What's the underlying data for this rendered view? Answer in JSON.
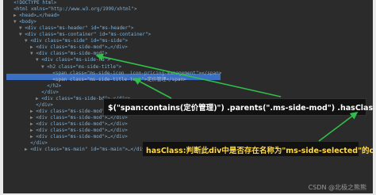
{
  "dom_lines": [
    {
      "indent": 0,
      "tri": "",
      "text": "<!DOCTYPE html>"
    },
    {
      "indent": 0,
      "tri": "",
      "text": "<html xmlns=\"http://www.w3.org/1999/xhtml\">"
    },
    {
      "indent": 1,
      "tri": "▶",
      "text": "<head>…</head>"
    },
    {
      "indent": 1,
      "tri": "▼",
      "text": "<body>"
    },
    {
      "indent": 2,
      "tri": "▼",
      "text": "<div class=\"ms-header\" id=\"ms-header\">"
    },
    {
      "indent": 2,
      "tri": "▼",
      "text": "<div class=\"ms-container\" id=\"ms-container\">"
    },
    {
      "indent": 3,
      "tri": "▼",
      "text": "<div class=\"ms-side\" id=\"ms-side\">"
    },
    {
      "indent": 4,
      "tri": "▶",
      "text": "<div class=\"ms-side-mod\">…</div>"
    },
    {
      "indent": 4,
      "tri": "▼",
      "text": "<div class=\"ms-side-mod\">"
    },
    {
      "indent": 5,
      "tri": "▼",
      "text": "<div class=\"ms-side-hd\">"
    },
    {
      "indent": 6,
      "tri": "▼",
      "text": "<h2 class=\"ms-side-title\">"
    },
    {
      "indent": 7,
      "tri": "",
      "text": "<span class=\"ms-side-icon  icon-pricing-management\"></span>"
    },
    {
      "indent": 7,
      "tri": "",
      "text": "<span class=\"ms-side-title-text\">定价管理</span>",
      "selected": true
    },
    {
      "indent": 6,
      "tri": "",
      "text": "</h2>"
    },
    {
      "indent": 5,
      "tri": "",
      "text": "</div>"
    },
    {
      "indent": 5,
      "tri": "▶",
      "text": "<div class=\"ms-side-bd\">…</div>"
    },
    {
      "indent": 4,
      "tri": "",
      "text": "</div>"
    },
    {
      "indent": 4,
      "tri": "▶",
      "text": "<div class=\"ms-side-mod\">…</div>"
    },
    {
      "indent": 4,
      "tri": "▶",
      "text": "<div class=\"ms-side-mod\">…</div>"
    },
    {
      "indent": 4,
      "tri": "▶",
      "text": "<div class=\"ms-side-mod\">…</div>"
    },
    {
      "indent": 4,
      "tri": "▶",
      "text": "<div class=\"ms-side-mod\">…</div>"
    },
    {
      "indent": 4,
      "tri": "▶",
      "text": "<div class=\"ms-side-mod\">…</div>"
    },
    {
      "indent": 3,
      "tri": "",
      "text": "</div>"
    },
    {
      "indent": 3,
      "tri": "▶",
      "text": "<div class=\"ms-main\" id=\"ms-main\">…</div>"
    }
  ],
  "annotations": {
    "selector_expr": "$(\"span:contains(定价管理)\") .parents(\".ms-side-mod\") .hasClass(\"ms-side-selected\")",
    "hasclass_note": "hasClass:判断此div中是否存在名称为\"ms-side-selected\"的class"
  },
  "watermark": "CSDN @北极之熊熊",
  "colors": {
    "background": "#2b2b2b",
    "selection": "#3a6fc4",
    "arrow": "#2fbf4a",
    "note": "#ffd84a"
  }
}
